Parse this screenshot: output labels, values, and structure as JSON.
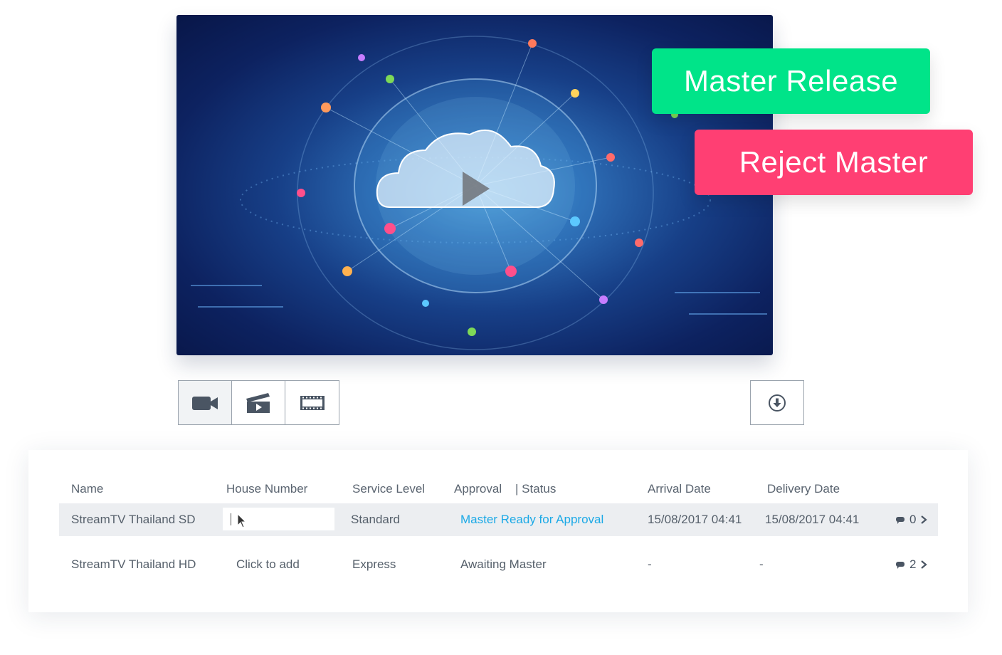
{
  "actions": {
    "release_label": "Master Release",
    "reject_label": "Reject Master"
  },
  "toolbar": {
    "tools": [
      "video-camera-icon",
      "clapperboard-icon",
      "film-strip-icon"
    ],
    "download_icon": "download-icon"
  },
  "table": {
    "headers": {
      "name": "Name",
      "house_number": "House Number",
      "service_level": "Service Level",
      "approval": "Approval",
      "status": "| Status",
      "arrival_date": "Arrival Date",
      "delivery_date": "Delivery Date"
    },
    "rows": [
      {
        "name": "StreamTV Thailand SD",
        "house_number": "",
        "service_level": "Standard",
        "status": "Master Ready for Approval",
        "arrival_date": "15/08/2017 04:41",
        "delivery_date": "15/08/2017 04:41",
        "comments": "0"
      },
      {
        "name": "StreamTV Thailand HD",
        "house_number": "Click to add",
        "service_level": "Express",
        "status": "Awaiting Master",
        "arrival_date": "-",
        "delivery_date": "-",
        "comments": "2"
      }
    ]
  },
  "colors": {
    "release": "#00e489",
    "reject": "#ff3f73",
    "status_link": "#1ba9e6"
  }
}
